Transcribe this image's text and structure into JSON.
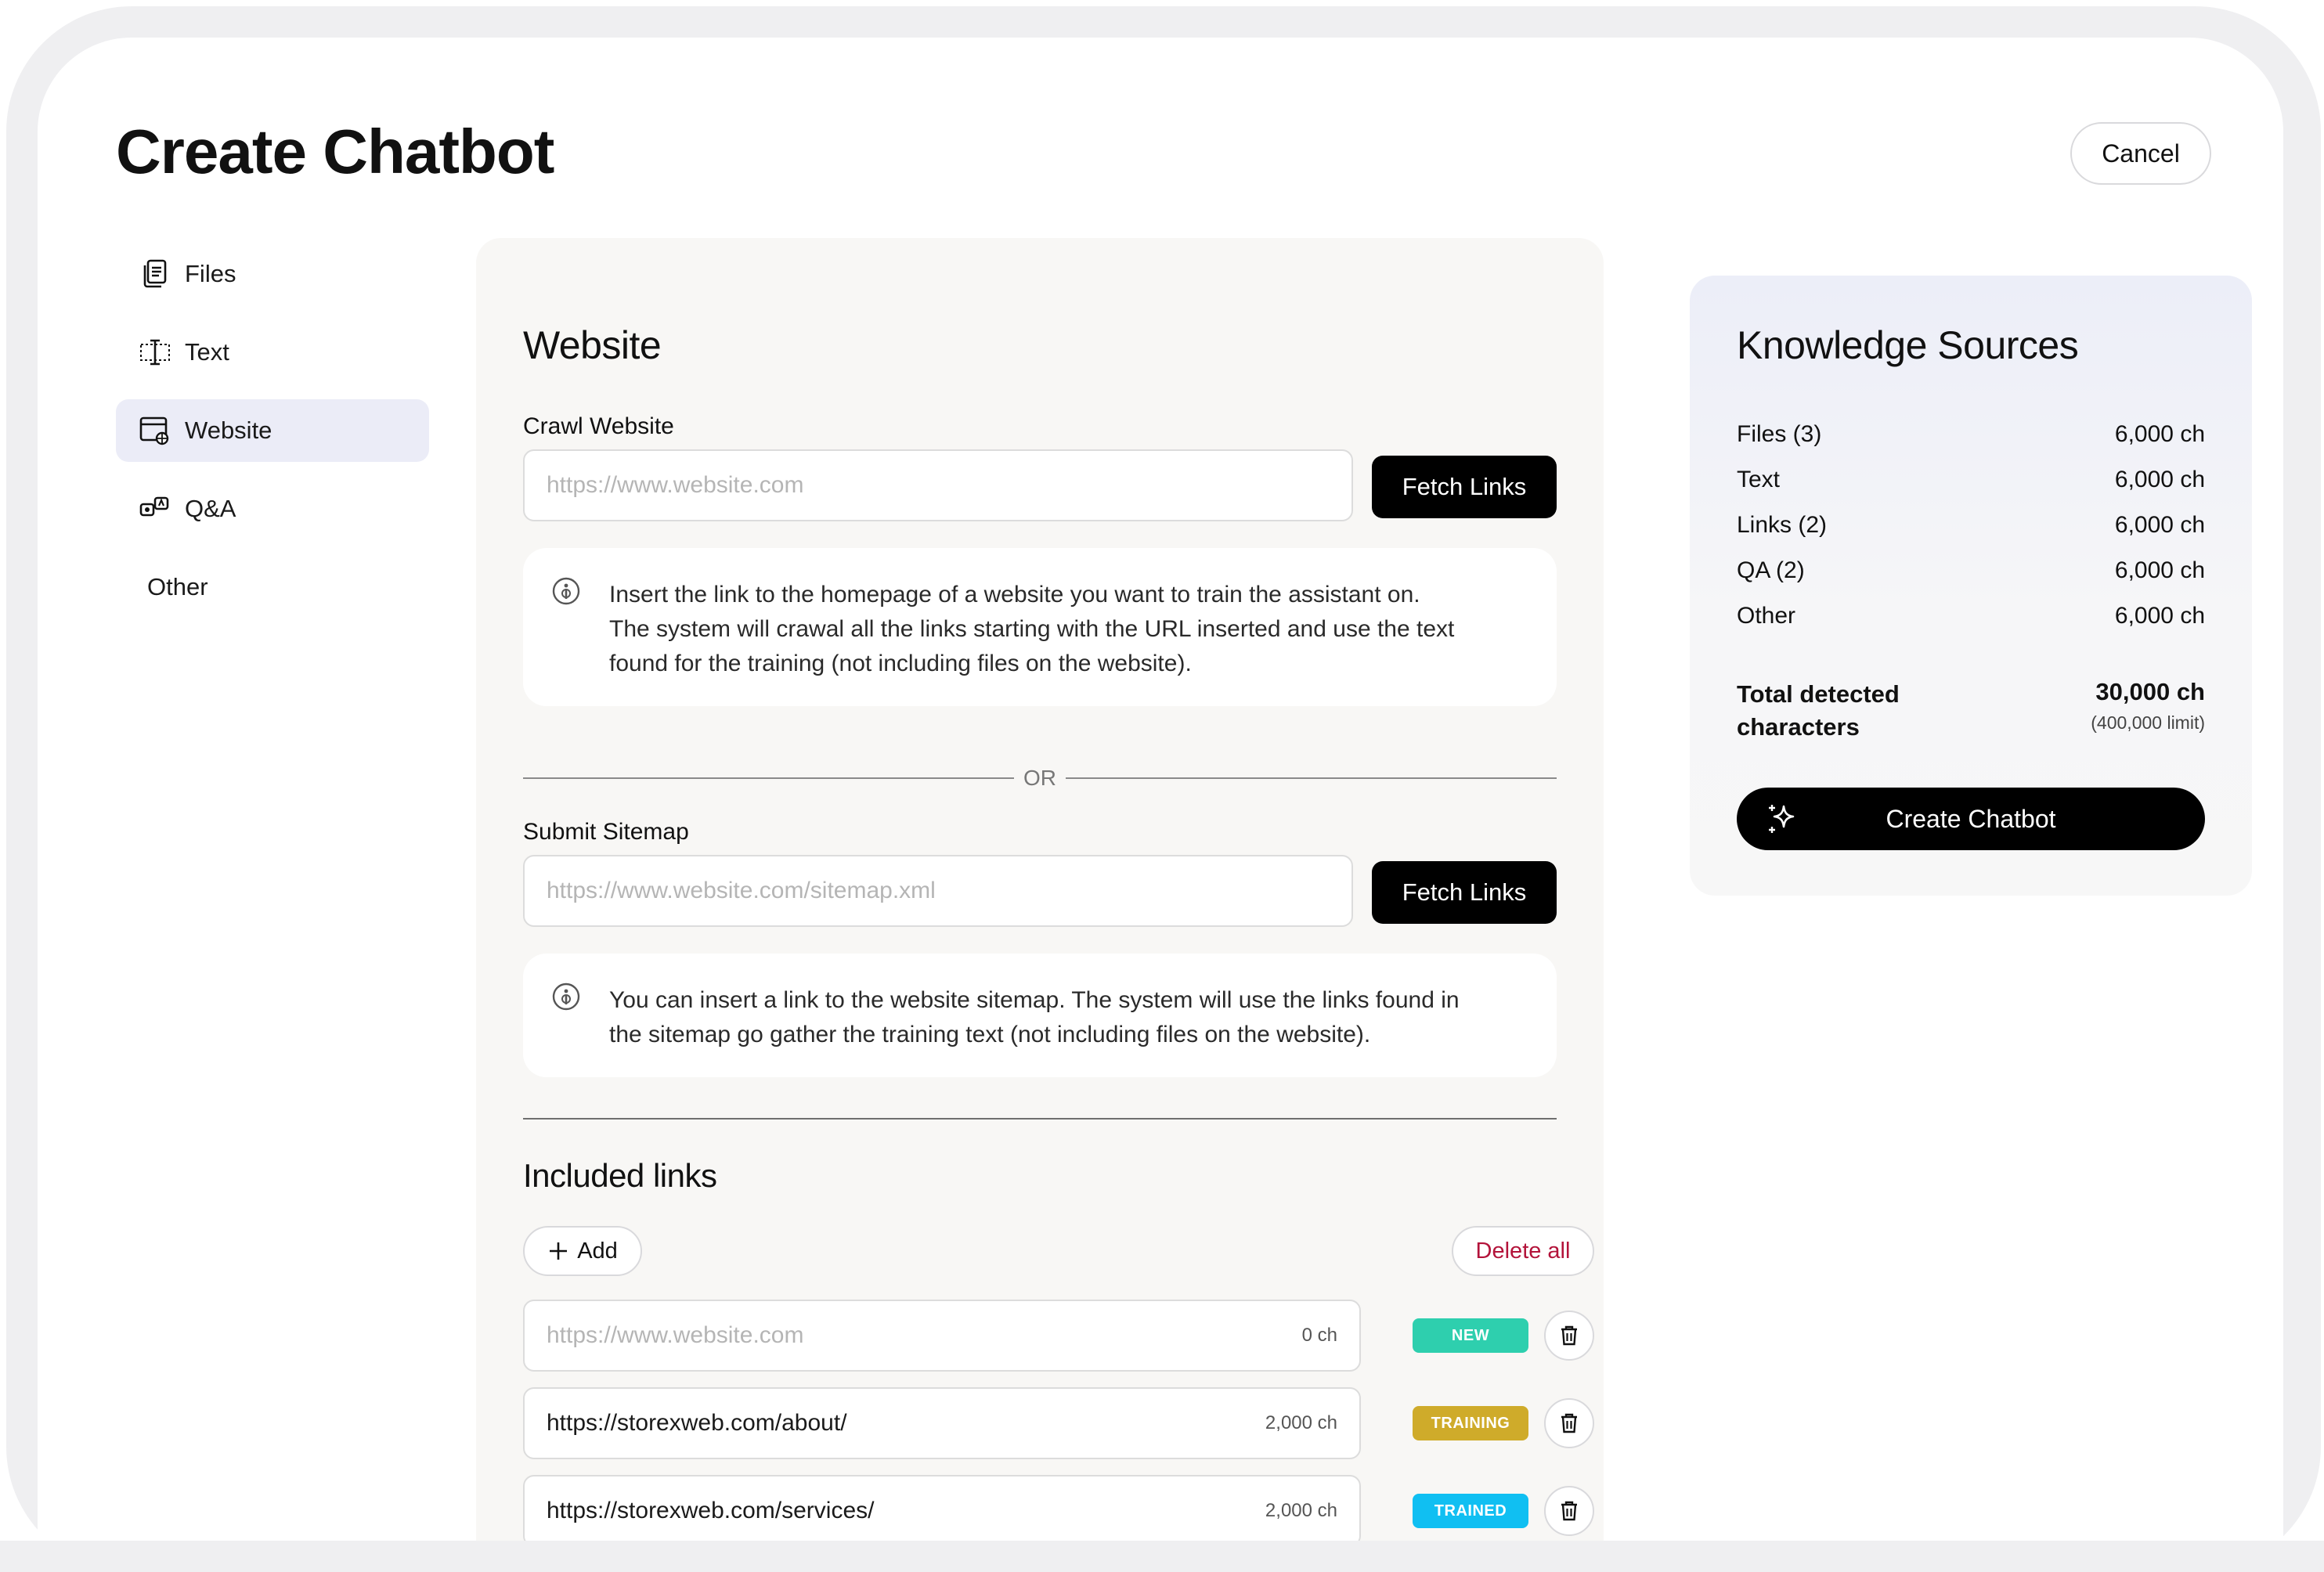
{
  "header": {
    "title": "Create Chatbot",
    "cancel_label": "Cancel"
  },
  "sidebar": {
    "items": [
      {
        "label": "Files",
        "icon": "files-icon"
      },
      {
        "label": "Text",
        "icon": "text-cursor-icon"
      },
      {
        "label": "Website",
        "icon": "browser-icon",
        "active": true
      },
      {
        "label": "Q&A",
        "icon": "qa-icon"
      },
      {
        "label": "Other"
      }
    ]
  },
  "website": {
    "title": "Website",
    "crawl": {
      "label": "Crawl Website",
      "placeholder": "https://www.website.com",
      "button": "Fetch Links",
      "info_lines": [
        "Insert the link to the homepage of a website you want to train the assistant on.",
        "The system will crawal all the links starting with the URL inserted and use the text",
        "found for the training (not including files on the website)."
      ]
    },
    "or_label": "OR",
    "sitemap": {
      "label": "Submit Sitemap",
      "placeholder": "https://www.website.com/sitemap.xml",
      "button": "Fetch Links",
      "info_lines": [
        "You can insert a link to the website sitemap. The system will use the links found in",
        "the sitemap go gather the training text (not including files on the website)."
      ]
    },
    "included": {
      "title": "Included links",
      "add_label": "Add",
      "delete_all_label": "Delete all",
      "links": [
        {
          "url": "https://www.website.com",
          "placeholder": true,
          "count": "0 ch",
          "status": "NEW",
          "status_color": "#2ecfae"
        },
        {
          "url": "https://storexweb.com/about/",
          "placeholder": false,
          "count": "2,000 ch",
          "status": "TRAINING",
          "status_color": "#cfab2a"
        },
        {
          "url": "https://storexweb.com/services/",
          "placeholder": false,
          "count": "2,000 ch",
          "status": "TRAINED",
          "status_color": "#10bff2"
        }
      ]
    }
  },
  "knowledge": {
    "title": "Knowledge Sources",
    "rows": [
      {
        "label": "Files (3)",
        "value": "6,000 ch"
      },
      {
        "label": "Text",
        "value": "6,000 ch"
      },
      {
        "label": "Links (2)",
        "value": "6,000 ch"
      },
      {
        "label": "QA (2)",
        "value": "6,000 ch"
      },
      {
        "label": "Other",
        "value": "6,000 ch"
      }
    ],
    "total_label": "Total detected characters",
    "total_value": "30,000 ch",
    "total_limit": "(400,000 limit)",
    "create_label": "Create Chatbot"
  },
  "colors": {
    "accent_black": "#000000",
    "active_nav": "#ebecf7",
    "delete_red": "#b3133a"
  }
}
